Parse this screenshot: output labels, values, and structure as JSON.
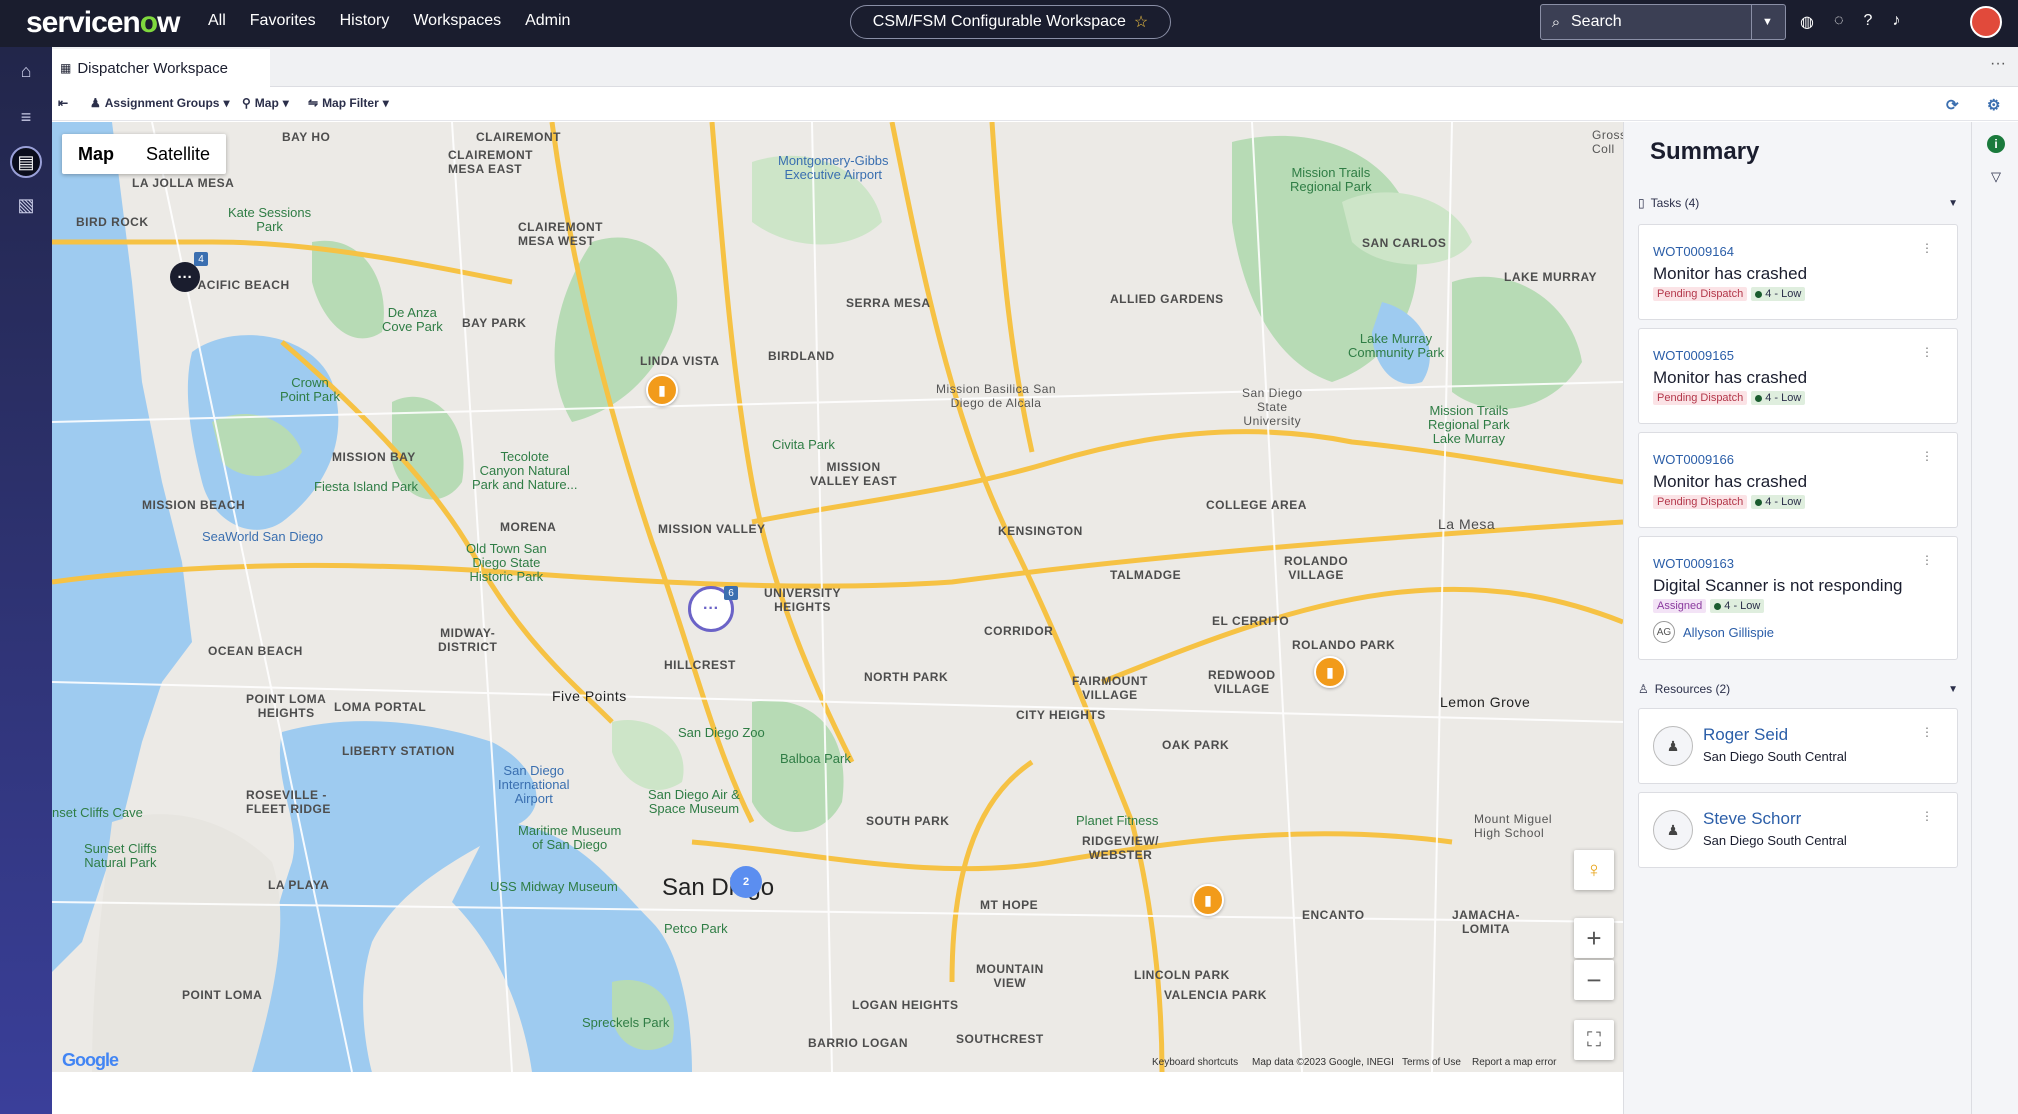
{
  "topbar": {
    "logo_pre": "servicen",
    "logo_o": "o",
    "logo_post": "w",
    "nav": [
      "All",
      "Favorites",
      "History",
      "Workspaces",
      "Admin"
    ],
    "workspace_title": "CSM/FSM Configurable Workspace",
    "search_placeholder": "Search"
  },
  "tab": {
    "label": "Dispatcher Workspace"
  },
  "toolbar": {
    "assignment_groups": "Assignment Groups",
    "map": "Map",
    "map_filter": "Map Filter"
  },
  "map": {
    "type_map": "Map",
    "type_satellite": "Satellite",
    "google": "Google",
    "footer": {
      "shortcuts": "Keyboard shortcuts",
      "mapdata": "Map data ©2023 Google, INEGI",
      "terms": "Terms of Use",
      "report": "Report a map error"
    },
    "clusters": {
      "a": "4",
      "b": "6",
      "c": "2"
    },
    "labels": {
      "claremont": "CLAIREMONT",
      "bay_ho": "BAY HO",
      "claremont_mesa_east": "CLAIREMONT\nMESA EAST",
      "la_jolla_mesa": "LA JOLLA MESA",
      "bird_rock": "BIRD ROCK",
      "pacific_beach": "PACIFIC BEACH",
      "clairemont_mesa_west": "CLAIREMONT\nMESA WEST",
      "serra_mesa": "SERRA MESA",
      "allied_gardens": "ALLIED GARDENS",
      "san_carlos": "SAN CARLOS",
      "lake_murray": "LAKE MURRAY",
      "bay_park": "BAY PARK",
      "linda_vista": "LINDA VISTA",
      "birdland": "BIRDLAND",
      "mission_bay": "MISSION BAY",
      "mission_valley_east": "MISSION\nVALLEY EAST",
      "mission_beach": "MISSION BEACH",
      "morena": "MORENA",
      "mission_valley": "MISSION VALLEY",
      "kensington": "KENSINGTON",
      "college_area": "COLLEGE AREA",
      "la_mesa": "La Mesa",
      "talmadge": "TALMADGE",
      "rolando": "ROLANDO\nVILLAGE",
      "university_heights": "UNIVERSITY\nHEIGHTS",
      "corridor": "CORRIDOR",
      "el_cerrito": "EL CERRITO",
      "midway_district": "MIDWAY-\nDISTRICT",
      "hillcrest": "HILLCREST",
      "north_park": "NORTH PARK",
      "fairmount_village": "FAIRMOUNT\nVILLAGE",
      "rolando_park": "ROLANDO PARK",
      "redwood_village": "REDWOOD\nVILLAGE",
      "ocean_beach": "OCEAN BEACH",
      "five_points": "Five Points",
      "point_loma_heights": "POINT LOMA\nHEIGHTS",
      "loma_portal": "LOMA PORTAL",
      "city_heights": "CITY HEIGHTS",
      "lemon_grove": "Lemon Grove",
      "liberty_station": "LIBERTY STATION",
      "oak_park": "OAK PARK",
      "roseville": "ROSEVILLE -\nFLEET RIDGE",
      "south_park": "SOUTH PARK",
      "ridgeview": "RIDGEVIEW/\nWEBSTER",
      "la_playa": "LA PLAYA",
      "san_diego": "San Diego",
      "mt_hope": "MT HOPE",
      "encanto": "ENCANTO",
      "jamacha": "JAMACHA-\nLOMITA",
      "point_loma": "POINT LOMA",
      "mountain_view": "MOUNTAIN\nVIEW",
      "lincoln_park": "LINCOLN PARK",
      "valencia_park": "VALENCIA PARK",
      "logan_heights": "LOGAN HEIGHTS",
      "barrio_logan": "BARRIO LOGAN",
      "southcrest": "SOUTHCREST"
    },
    "poi": {
      "montgomery": "Montgomery-Gibbs\nExecutive Airport",
      "kate_sessions": "Kate Sessions\nPark",
      "de_anza": "De Anza\nCove Park",
      "crown_point": "Crown\nPoint Park",
      "tecolote": "Tecolote\nCanyon Natural\nPark and Nature...",
      "fiesta_island": "Fiesta Island Park",
      "seaworld": "SeaWorld San Diego",
      "old_town": "Old Town San\nDiego State\nHistoric Park",
      "civita": "Civita Park",
      "mission_basilica": "Mission Basilica San\nDiego de Alcala",
      "sdsu": "San Diego\nState\nUniversity",
      "mission_trails": "Mission Trails\nRegional Park",
      "lake_murray_park": "Lake Murray\nCommunity Park",
      "mission_trails_lake": "Mission Trails\nRegional Park\nLake Murray",
      "sd_zoo": "San Diego Zoo",
      "balboa": "Balboa Park",
      "sd_airport": "San Diego\nInternational\nAirport",
      "air_space": "San Diego Air &\nSpace Museum",
      "maritime": "Maritime Museum\nof San Diego",
      "midway": "USS Midway Museum",
      "petco": "Petco Park",
      "sunset_cliffs": "Sunset Cliffs\nNatural Park",
      "sunset_cliffs_cave": "nset Cliffs Cave",
      "planet_fitness": "Planet Fitness",
      "mount_miguel": "Mount Miguel\nHigh School",
      "spreckels": "Spreckels Park",
      "gross": "Gross\nColl"
    }
  },
  "summary": {
    "title": "Summary",
    "tasks_header": "Tasks (4)",
    "resources_header": "Resources (2)",
    "tasks": [
      {
        "number": "WOT0009164",
        "title": "Monitor has crashed",
        "state": "Pending Dispatch",
        "priority": "4 - Low"
      },
      {
        "number": "WOT0009165",
        "title": "Monitor has crashed",
        "state": "Pending Dispatch",
        "priority": "4 - Low"
      },
      {
        "number": "WOT0009166",
        "title": "Monitor has crashed",
        "state": "Pending Dispatch",
        "priority": "4 - Low"
      },
      {
        "number": "WOT0009163",
        "title": "Digital Scanner is not responding",
        "state": "Assigned",
        "priority": "4 - Low",
        "assignee_initials": "AG",
        "assignee": "Allyson Gillispie"
      }
    ],
    "resources": [
      {
        "name": "Roger Seid",
        "location": "San Diego South Central"
      },
      {
        "name": "Steve Schorr",
        "location": "San Diego South Central"
      }
    ]
  },
  "colors": {
    "topbar": "#1a1d2e",
    "accent": "#7fd83e",
    "pending": "#b3374a",
    "link": "#2b5ea8",
    "pin": "#f29b1a"
  }
}
